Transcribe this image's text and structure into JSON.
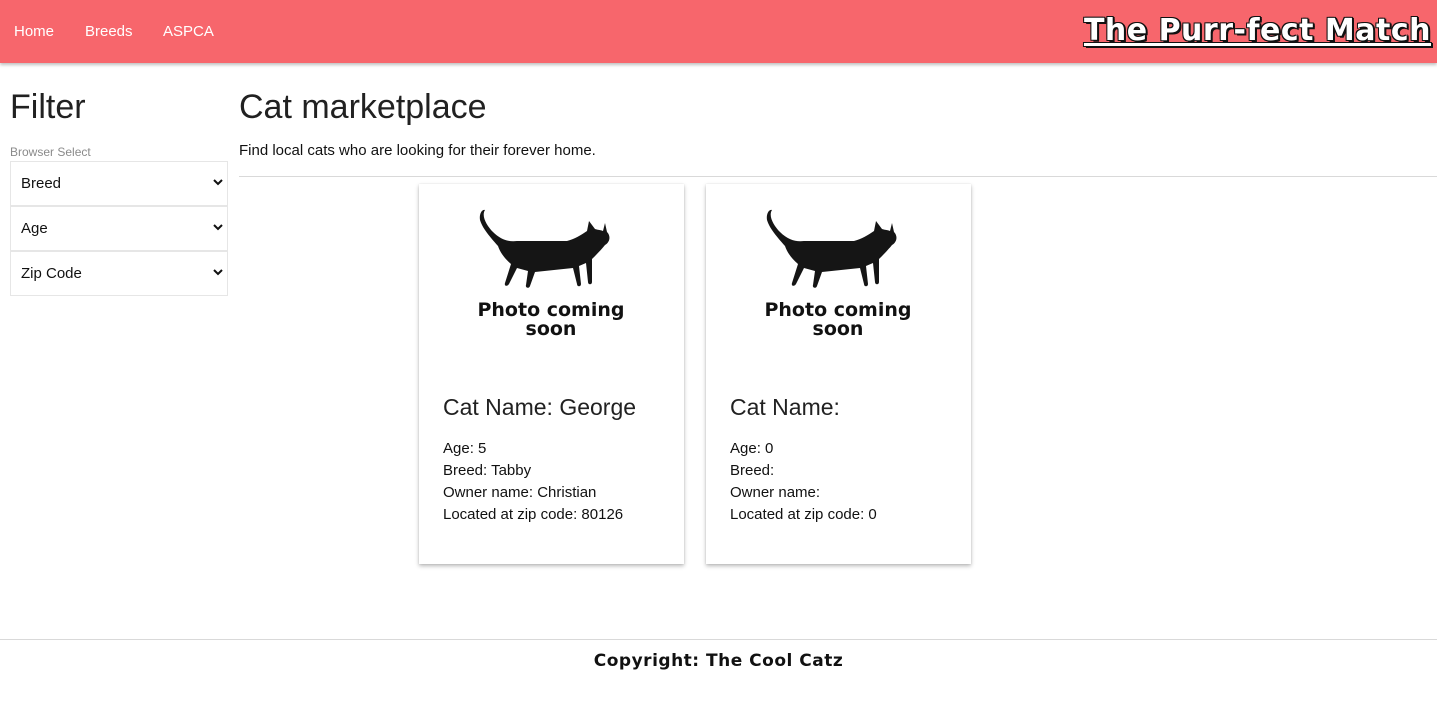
{
  "nav": {
    "links": [
      "Home",
      "Breeds",
      "ASPCA"
    ],
    "brand": "The Purr-fect Match",
    "color": "#f7666c"
  },
  "sidebar": {
    "title": "Filter",
    "select_label": "Browser Select",
    "selects": [
      "Breed",
      "Age",
      "Zip Code"
    ]
  },
  "main": {
    "title": "Cat marketplace",
    "subtitle": "Find local cats who are looking for their forever home."
  },
  "cards": [
    {
      "photo_text_1": "Photo coming",
      "photo_text_2": "soon",
      "name": "Cat Name: George",
      "age": "Age: 5",
      "breed": "Breed: Tabby",
      "owner": "Owner name: Christian",
      "zip": "Located at zip code: 80126"
    },
    {
      "photo_text_1": "Photo coming",
      "photo_text_2": "soon",
      "name": "Cat Name:",
      "age": "Age: 0",
      "breed": "Breed:",
      "owner": "Owner name:",
      "zip": "Located at zip code: 0"
    }
  ],
  "footer": {
    "text": "Copyright: The Cool Catz"
  },
  "icons": {
    "select_chevron": "chevron-down-icon",
    "cat_placeholder": "cat-silhouette-icon"
  }
}
